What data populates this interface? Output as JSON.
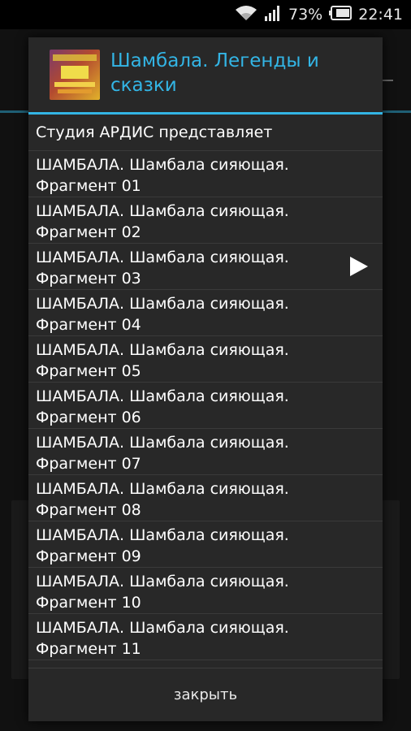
{
  "status_bar": {
    "battery_percent": "73%",
    "time": "22:41",
    "icons": [
      "wifi-icon",
      "signal-icon",
      "battery-icon"
    ]
  },
  "dialog": {
    "title": "Шамбала. Легенды и сказки",
    "accent_color": "#33b5e5",
    "cover_icon": "album-cover",
    "items": [
      {
        "label": "Студия АРДИС представляет"
      },
      {
        "label": "ШАМБАЛА. Шамбала сияющая. Фрагмент 01"
      },
      {
        "label": "ШАМБАЛА. Шамбала сияющая. Фрагмент 02"
      },
      {
        "label": "ШАМБАЛА. Шамбала сияющая. Фрагмент 03",
        "playing": true
      },
      {
        "label": "ШАМБАЛА. Шамбала сияющая. Фрагмент 04"
      },
      {
        "label": "ШАМБАЛА. Шамбала сияющая. Фрагмент 05"
      },
      {
        "label": "ШАМБАЛА. Шамбала сияющая. Фрагмент 06"
      },
      {
        "label": "ШАМБАЛА. Шамбала сияющая. Фрагмент 07"
      },
      {
        "label": "ШАМБАЛА. Шамбала сияющая. Фрагмент 08"
      },
      {
        "label": "ШАМБАЛА. Шамбала сияющая. Фрагмент 09"
      },
      {
        "label": "ШАМБАЛА. Шамбала сияющая. Фрагмент 10"
      },
      {
        "label": "ШАМБАЛА. Шамбала сияющая. Фрагмент 11"
      }
    ],
    "close_label": "закрыть"
  }
}
